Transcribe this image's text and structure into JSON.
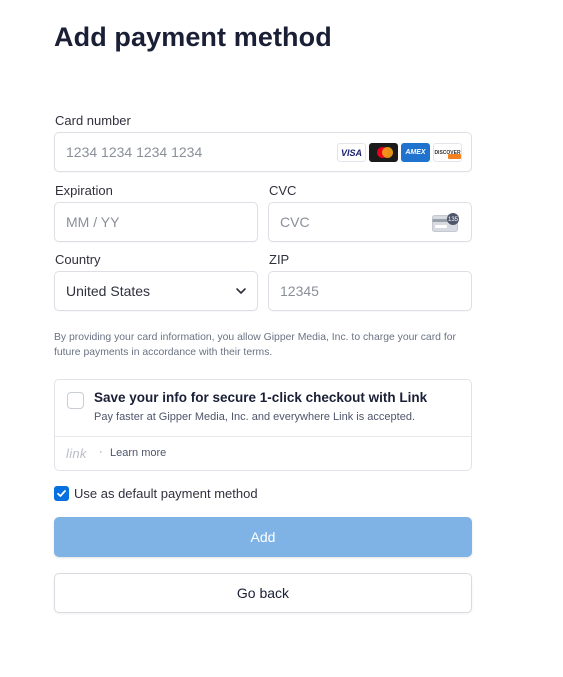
{
  "page": {
    "title": "Add payment method"
  },
  "form": {
    "card_number": {
      "label": "Card number",
      "placeholder": "1234 1234 1234 1234",
      "brands": [
        "VISA",
        "mastercard",
        "AMEX",
        "DISCOVER"
      ]
    },
    "expiration": {
      "label": "Expiration",
      "placeholder": "MM / YY"
    },
    "cvc": {
      "label": "CVC",
      "placeholder": "CVC",
      "icon": "card-back-cvc-icon",
      "icon_text": "135"
    },
    "country": {
      "label": "Country",
      "value": "United States"
    },
    "zip": {
      "label": "ZIP",
      "placeholder": "12345"
    }
  },
  "notice": "By providing your card information, you allow Gipper Media, Inc. to charge your card for future payments in accordance with their terms.",
  "link": {
    "title": "Save your info for secure 1-click checkout with Link",
    "subtitle": "Pay faster at Gipper Media, Inc. and everywhere Link is accepted.",
    "logo": "link",
    "separator": "·",
    "learn_more": "Learn more",
    "checked": false
  },
  "default_method": {
    "label": "Use as default payment method",
    "checked": true
  },
  "buttons": {
    "add": "Add",
    "back": "Go back"
  },
  "colors": {
    "accent": "#0570de",
    "add_button_disabled": "#7fb3e6",
    "text": "#1a1f36"
  }
}
